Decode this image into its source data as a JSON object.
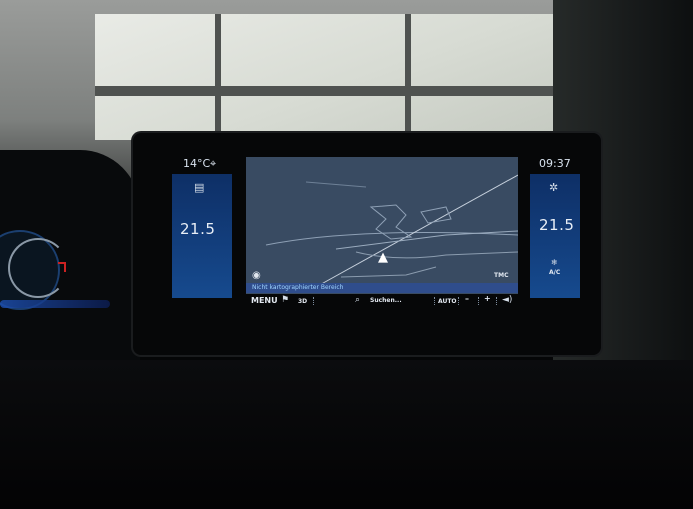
{
  "header": {
    "outside_temp": "14°C",
    "clock": "09:37"
  },
  "climate": {
    "driver_temp": "21.5",
    "passenger_temp": "21.5",
    "ac_label": "A/C"
  },
  "map": {
    "status_text": "Nicht kartographierter Bereich",
    "traffic_label": "TMC"
  },
  "toolbar": {
    "menu_label": "MENU",
    "view_3d_label": "3D",
    "search_label": "Suchen...",
    "zoom_auto_label": "AUTO",
    "zoom_out_label": "–",
    "zoom_in_label": "+"
  },
  "colors": {
    "panel_blue": "#164a8e",
    "map_bg": "#394b62",
    "status_bar": "#2f4d8c",
    "status_text": "#9fd4ff"
  }
}
